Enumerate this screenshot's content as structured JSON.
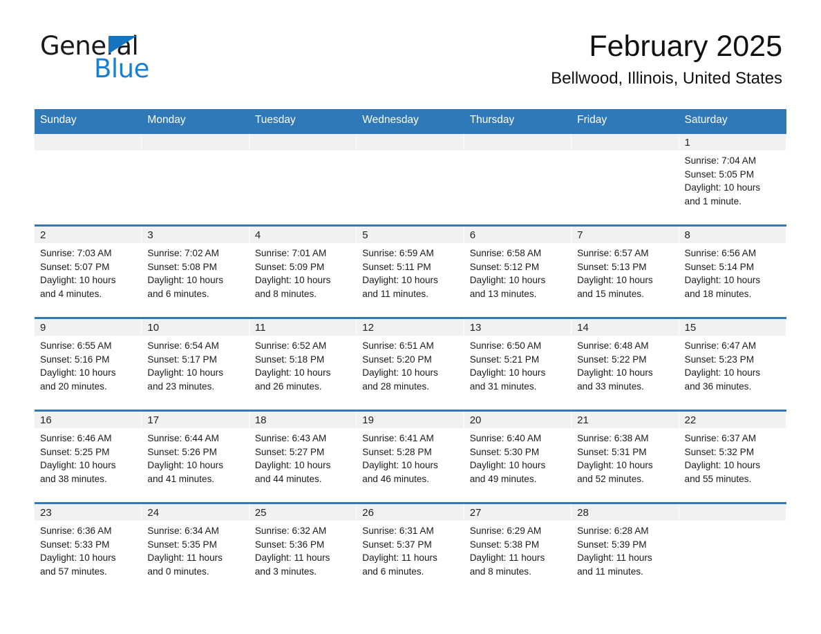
{
  "brand": {
    "name_part1": "General",
    "name_part2": "Blue",
    "accent_color": "#1a7fd4",
    "header_color": "#2f79b8"
  },
  "header": {
    "title": "February 2025",
    "subtitle": "Bellwood, Illinois, United States"
  },
  "weekdays": [
    "Sunday",
    "Monday",
    "Tuesday",
    "Wednesday",
    "Thursday",
    "Friday",
    "Saturday"
  ],
  "weeks": [
    [
      {
        "day": "",
        "sunrise": "",
        "sunset": "",
        "daylight": "",
        "daylight2": ""
      },
      {
        "day": "",
        "sunrise": "",
        "sunset": "",
        "daylight": "",
        "daylight2": ""
      },
      {
        "day": "",
        "sunrise": "",
        "sunset": "",
        "daylight": "",
        "daylight2": ""
      },
      {
        "day": "",
        "sunrise": "",
        "sunset": "",
        "daylight": "",
        "daylight2": ""
      },
      {
        "day": "",
        "sunrise": "",
        "sunset": "",
        "daylight": "",
        "daylight2": ""
      },
      {
        "day": "",
        "sunrise": "",
        "sunset": "",
        "daylight": "",
        "daylight2": ""
      },
      {
        "day": "1",
        "sunrise": "Sunrise: 7:04 AM",
        "sunset": "Sunset: 5:05 PM",
        "daylight": "Daylight: 10 hours",
        "daylight2": "and 1 minute."
      }
    ],
    [
      {
        "day": "2",
        "sunrise": "Sunrise: 7:03 AM",
        "sunset": "Sunset: 5:07 PM",
        "daylight": "Daylight: 10 hours",
        "daylight2": "and 4 minutes."
      },
      {
        "day": "3",
        "sunrise": "Sunrise: 7:02 AM",
        "sunset": "Sunset: 5:08 PM",
        "daylight": "Daylight: 10 hours",
        "daylight2": "and 6 minutes."
      },
      {
        "day": "4",
        "sunrise": "Sunrise: 7:01 AM",
        "sunset": "Sunset: 5:09 PM",
        "daylight": "Daylight: 10 hours",
        "daylight2": "and 8 minutes."
      },
      {
        "day": "5",
        "sunrise": "Sunrise: 6:59 AM",
        "sunset": "Sunset: 5:11 PM",
        "daylight": "Daylight: 10 hours",
        "daylight2": "and 11 minutes."
      },
      {
        "day": "6",
        "sunrise": "Sunrise: 6:58 AM",
        "sunset": "Sunset: 5:12 PM",
        "daylight": "Daylight: 10 hours",
        "daylight2": "and 13 minutes."
      },
      {
        "day": "7",
        "sunrise": "Sunrise: 6:57 AM",
        "sunset": "Sunset: 5:13 PM",
        "daylight": "Daylight: 10 hours",
        "daylight2": "and 15 minutes."
      },
      {
        "day": "8",
        "sunrise": "Sunrise: 6:56 AM",
        "sunset": "Sunset: 5:14 PM",
        "daylight": "Daylight: 10 hours",
        "daylight2": "and 18 minutes."
      }
    ],
    [
      {
        "day": "9",
        "sunrise": "Sunrise: 6:55 AM",
        "sunset": "Sunset: 5:16 PM",
        "daylight": "Daylight: 10 hours",
        "daylight2": "and 20 minutes."
      },
      {
        "day": "10",
        "sunrise": "Sunrise: 6:54 AM",
        "sunset": "Sunset: 5:17 PM",
        "daylight": "Daylight: 10 hours",
        "daylight2": "and 23 minutes."
      },
      {
        "day": "11",
        "sunrise": "Sunrise: 6:52 AM",
        "sunset": "Sunset: 5:18 PM",
        "daylight": "Daylight: 10 hours",
        "daylight2": "and 26 minutes."
      },
      {
        "day": "12",
        "sunrise": "Sunrise: 6:51 AM",
        "sunset": "Sunset: 5:20 PM",
        "daylight": "Daylight: 10 hours",
        "daylight2": "and 28 minutes."
      },
      {
        "day": "13",
        "sunrise": "Sunrise: 6:50 AM",
        "sunset": "Sunset: 5:21 PM",
        "daylight": "Daylight: 10 hours",
        "daylight2": "and 31 minutes."
      },
      {
        "day": "14",
        "sunrise": "Sunrise: 6:48 AM",
        "sunset": "Sunset: 5:22 PM",
        "daylight": "Daylight: 10 hours",
        "daylight2": "and 33 minutes."
      },
      {
        "day": "15",
        "sunrise": "Sunrise: 6:47 AM",
        "sunset": "Sunset: 5:23 PM",
        "daylight": "Daylight: 10 hours",
        "daylight2": "and 36 minutes."
      }
    ],
    [
      {
        "day": "16",
        "sunrise": "Sunrise: 6:46 AM",
        "sunset": "Sunset: 5:25 PM",
        "daylight": "Daylight: 10 hours",
        "daylight2": "and 38 minutes."
      },
      {
        "day": "17",
        "sunrise": "Sunrise: 6:44 AM",
        "sunset": "Sunset: 5:26 PM",
        "daylight": "Daylight: 10 hours",
        "daylight2": "and 41 minutes."
      },
      {
        "day": "18",
        "sunrise": "Sunrise: 6:43 AM",
        "sunset": "Sunset: 5:27 PM",
        "daylight": "Daylight: 10 hours",
        "daylight2": "and 44 minutes."
      },
      {
        "day": "19",
        "sunrise": "Sunrise: 6:41 AM",
        "sunset": "Sunset: 5:28 PM",
        "daylight": "Daylight: 10 hours",
        "daylight2": "and 46 minutes."
      },
      {
        "day": "20",
        "sunrise": "Sunrise: 6:40 AM",
        "sunset": "Sunset: 5:30 PM",
        "daylight": "Daylight: 10 hours",
        "daylight2": "and 49 minutes."
      },
      {
        "day": "21",
        "sunrise": "Sunrise: 6:38 AM",
        "sunset": "Sunset: 5:31 PM",
        "daylight": "Daylight: 10 hours",
        "daylight2": "and 52 minutes."
      },
      {
        "day": "22",
        "sunrise": "Sunrise: 6:37 AM",
        "sunset": "Sunset: 5:32 PM",
        "daylight": "Daylight: 10 hours",
        "daylight2": "and 55 minutes."
      }
    ],
    [
      {
        "day": "23",
        "sunrise": "Sunrise: 6:36 AM",
        "sunset": "Sunset: 5:33 PM",
        "daylight": "Daylight: 10 hours",
        "daylight2": "and 57 minutes."
      },
      {
        "day": "24",
        "sunrise": "Sunrise: 6:34 AM",
        "sunset": "Sunset: 5:35 PM",
        "daylight": "Daylight: 11 hours",
        "daylight2": "and 0 minutes."
      },
      {
        "day": "25",
        "sunrise": "Sunrise: 6:32 AM",
        "sunset": "Sunset: 5:36 PM",
        "daylight": "Daylight: 11 hours",
        "daylight2": "and 3 minutes."
      },
      {
        "day": "26",
        "sunrise": "Sunrise: 6:31 AM",
        "sunset": "Sunset: 5:37 PM",
        "daylight": "Daylight: 11 hours",
        "daylight2": "and 6 minutes."
      },
      {
        "day": "27",
        "sunrise": "Sunrise: 6:29 AM",
        "sunset": "Sunset: 5:38 PM",
        "daylight": "Daylight: 11 hours",
        "daylight2": "and 8 minutes."
      },
      {
        "day": "28",
        "sunrise": "Sunrise: 6:28 AM",
        "sunset": "Sunset: 5:39 PM",
        "daylight": "Daylight: 11 hours",
        "daylight2": "and 11 minutes."
      },
      {
        "day": "",
        "sunrise": "",
        "sunset": "",
        "daylight": "",
        "daylight2": ""
      }
    ]
  ]
}
